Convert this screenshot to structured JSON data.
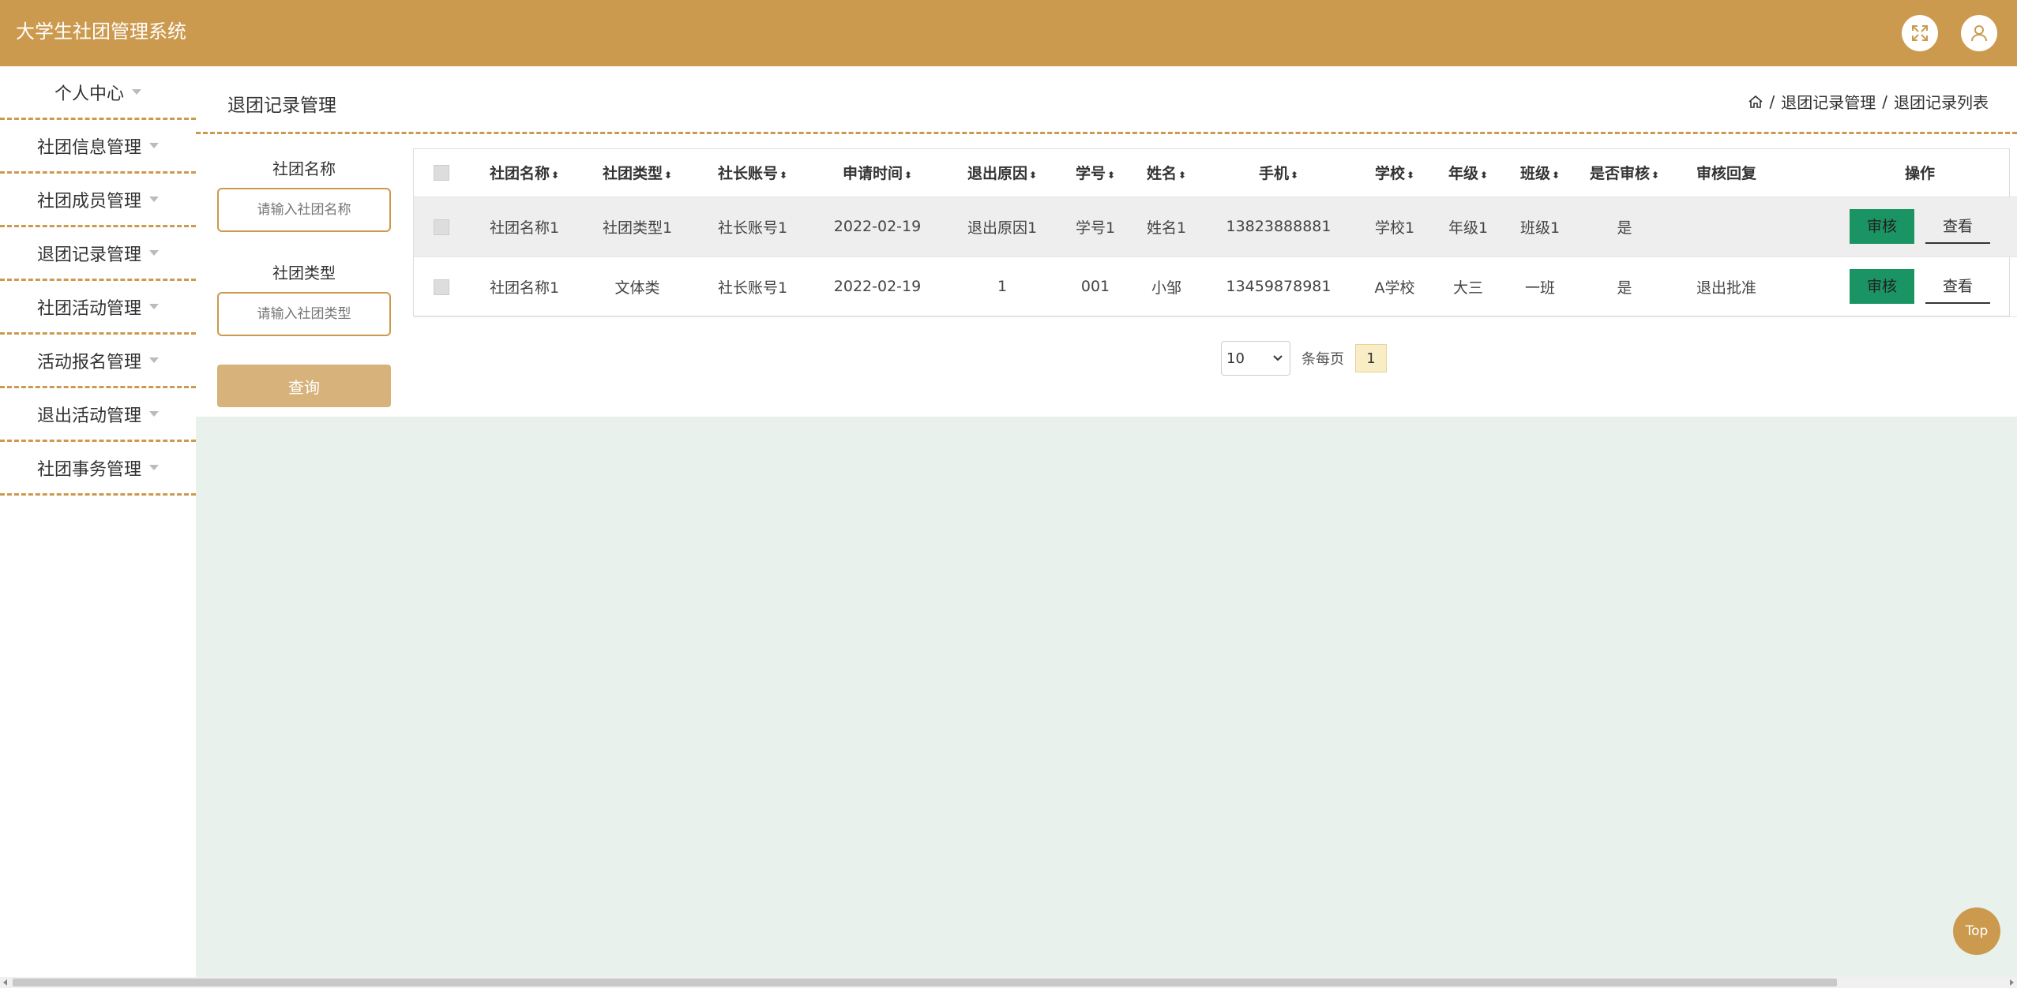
{
  "app": {
    "title": "大学生社团管理系统"
  },
  "sidebar": {
    "items": [
      {
        "label": "个人中心"
      },
      {
        "label": "社团信息管理"
      },
      {
        "label": "社团成员管理"
      },
      {
        "label": "退团记录管理"
      },
      {
        "label": "社团活动管理"
      },
      {
        "label": "活动报名管理"
      },
      {
        "label": "退出活动管理"
      },
      {
        "label": "社团事务管理"
      }
    ]
  },
  "page": {
    "title": "退团记录管理",
    "breadcrumb": {
      "sep": "/",
      "level1": "退团记录管理",
      "level2": "退团记录列表"
    }
  },
  "filter": {
    "name_label": "社团名称",
    "name_placeholder": "请输入社团名称",
    "type_label": "社团类型",
    "type_placeholder": "请输入社团类型",
    "search_label": "查询"
  },
  "table": {
    "headers": [
      "社团名称",
      "社团类型",
      "社长账号",
      "申请时间",
      "退出原因",
      "学号",
      "姓名",
      "手机",
      "学校",
      "年级",
      "班级",
      "是否审核",
      "审核回复",
      "操作"
    ],
    "sort_glyph": "⬍",
    "rows": [
      [
        "社团名称1",
        "社团类型1",
        "社长账号1",
        "2022-02-19",
        "退出原因1",
        "学号1",
        "姓名1",
        "13823888881",
        "学校1",
        "年级1",
        "班级1",
        "是",
        ""
      ],
      [
        "社团名称1",
        "文体类",
        "社长账号1",
        "2022-02-19",
        "1",
        "001",
        "小邹",
        "13459878981",
        "A学校",
        "大三",
        "一班",
        "是",
        "退出批准"
      ]
    ],
    "action_audit": "审核",
    "action_view": "查看"
  },
  "pager": {
    "page_size": "10",
    "per_page_label": "条每页",
    "current_page": "1"
  },
  "top_button": "Top",
  "colors": {
    "brand": "#cc9a4e",
    "audit": "#1a9463",
    "background": "#e8f1ec"
  }
}
